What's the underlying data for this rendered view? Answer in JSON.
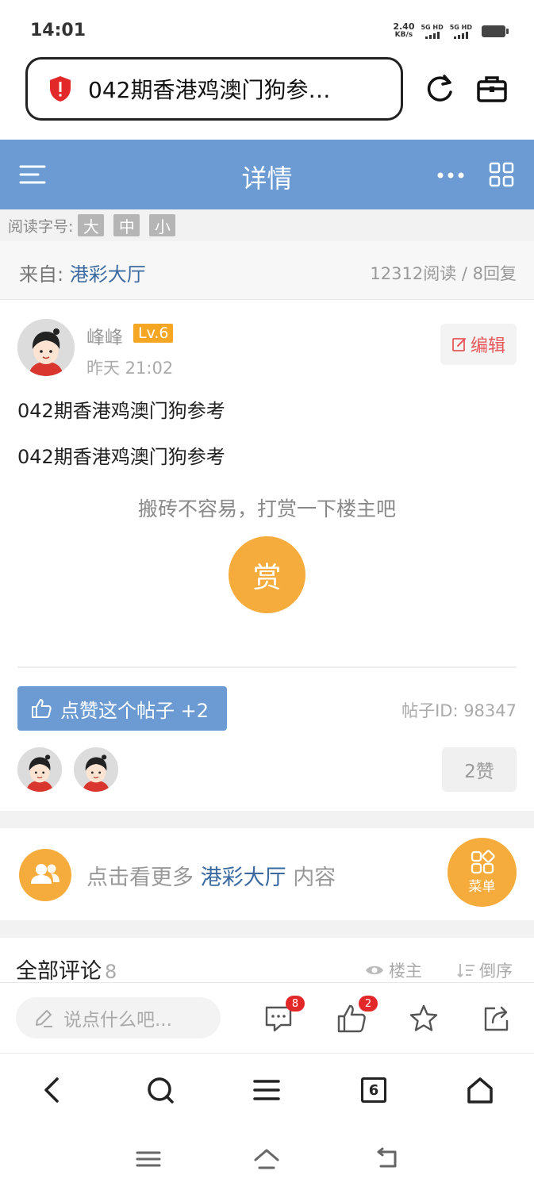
{
  "status_bar": {
    "time": "14:01",
    "net_speed_value": "2.40",
    "net_speed_unit": "KB/s",
    "signal_1": "5G HD",
    "signal_2": "5G HD"
  },
  "browser": {
    "url_title": "042期香港鸡澳门狗参…",
    "security_icon": "shield-alert-icon",
    "reload_icon": "reload-icon",
    "toolbox_icon": "toolbox-icon"
  },
  "header": {
    "title": "详情",
    "menu_icon": "menu-icon",
    "more_icon": "more-dots-icon",
    "grid_icon": "grid-icon",
    "background": "#6b9bd2"
  },
  "font_size_bar": {
    "label": "阅读字号:",
    "options": [
      "大",
      "中",
      "小"
    ]
  },
  "source": {
    "prefix": "来自:",
    "forum": "港彩大厅",
    "stats": "12312阅读 / 8回复"
  },
  "post": {
    "author": "峰峰",
    "level": "Lv.6",
    "time": "昨天 21:02",
    "edit_label": "编辑",
    "lines": [
      "042期香港鸡澳门狗参考",
      "042期香港鸡澳门狗参考"
    ],
    "reward_prompt": "搬砖不容易，打赏一下楼主吧",
    "reward_button": "赏",
    "like_label": "点赞这个帖子 +2",
    "post_id": "帖子ID: 98347",
    "like_count": "2赞"
  },
  "more_bar": {
    "prefix": "点击看更多",
    "forum": "港彩大厅",
    "suffix": "内容",
    "menu_label": "菜单"
  },
  "comments": {
    "title": "全部评论",
    "count": "8",
    "filter_owner": "楼主",
    "filter_order": "倒序"
  },
  "bottom_bar": {
    "input_placeholder": "说点什么吧...",
    "comment_badge": "8",
    "like_badge": "2"
  },
  "browser_nav": {
    "tab_count": "6"
  },
  "colors": {
    "accent_blue": "#6b9bd2",
    "link_blue": "#3a6aa0",
    "orange": "#f5ac3c",
    "badge_red": "#e3282a",
    "edit_red": "#e8575a"
  }
}
